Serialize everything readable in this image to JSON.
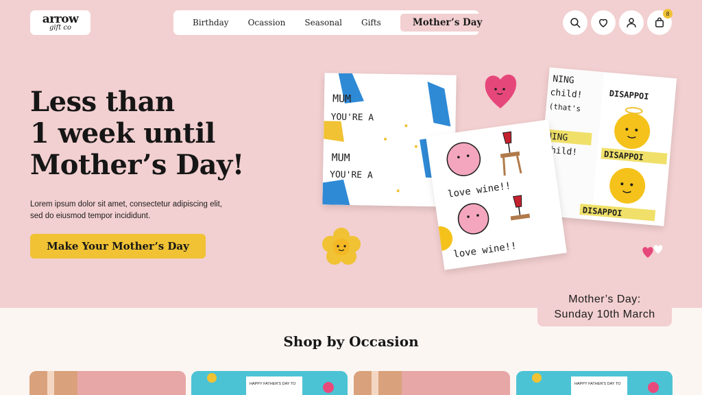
{
  "brand": {
    "logo_main": "arrow",
    "logo_sub": "gift co"
  },
  "nav": {
    "items": [
      "Birthday",
      "Ocassion",
      "Seasonal",
      "Gifts"
    ],
    "active": "Mother’s Day"
  },
  "header_icons": {
    "search": "search-icon",
    "wishlist": "heart-icon",
    "account": "user-icon",
    "cart": "bag-icon",
    "cart_count": "8"
  },
  "hero": {
    "title_line1": "Less than",
    "title_line2": "1 week until",
    "title_line3": "Mother’s Day!",
    "body_line1": "Lorem ipsum dolor sit amet, consectetur adipiscing elit,",
    "body_line2": "sed do eiusmod tempor incididunt.",
    "cta": "Make Your Mother’s Day"
  },
  "card_art": {
    "mum_text1": "MUM",
    "mum_text2": "YOU'RE A",
    "wine_text": "love wine!!",
    "disappoint_text": "DISAPPOI",
    "dis_left1": "NING",
    "dis_left2": "child!",
    "dis_left3": "(that's"
  },
  "date_banner": {
    "line1": "Mother’s Day:",
    "line2": "Sunday 10th March"
  },
  "shop": {
    "title": "Shop by Occasion",
    "tile_text": "HAPPY FATHER'S DAY TO"
  },
  "colors": {
    "background": "#f2cfd0",
    "accent_yellow": "#f0c234",
    "shop_background": "#fcf6f3",
    "text_dark": "#161616"
  }
}
